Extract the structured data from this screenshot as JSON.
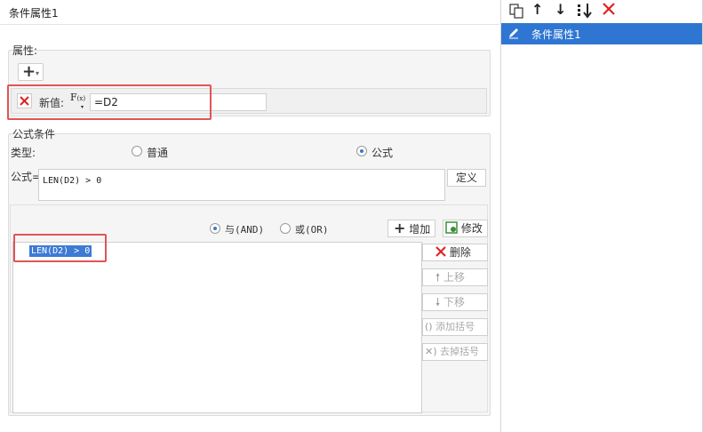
{
  "title": "条件属性1",
  "attributes": {
    "label": "属性:",
    "add_button_icon": "plus-icon",
    "row": {
      "delete_icon": "close-icon",
      "new_value_label": "新值:",
      "fx_main": "F",
      "fx_sub": "(x)",
      "value": "=D2"
    }
  },
  "formula_condition": {
    "label": "公式条件",
    "type_label": "类型:",
    "type_options": [
      "普通",
      "公式"
    ],
    "selected_type": "公式",
    "formula_label": "公式=",
    "formula_value": "LEN(D2) > 0",
    "define_button": "定义",
    "logic_options": [
      "与(AND)",
      "或(OR)"
    ],
    "selected_logic": "与(AND)",
    "add_button": "增加",
    "edit_button": "修改",
    "conditions": [
      "LEN(D2) > 0"
    ],
    "side_buttons": {
      "delete": "删除",
      "move_up": "上移",
      "move_down": "下移",
      "add_paren": "添加括号",
      "remove_paren": "去掉括号"
    }
  },
  "right_panel": {
    "toolbar_icons": [
      "copy-icon",
      "arrow-up-icon",
      "arrow-down-icon",
      "sort-down-icon",
      "close-icon"
    ],
    "items": [
      {
        "label": "条件属性1",
        "selected": true
      }
    ]
  },
  "colors": {
    "accent": "#2f76d2",
    "highlight_red": "#e05555",
    "delete_red": "#e02020"
  }
}
